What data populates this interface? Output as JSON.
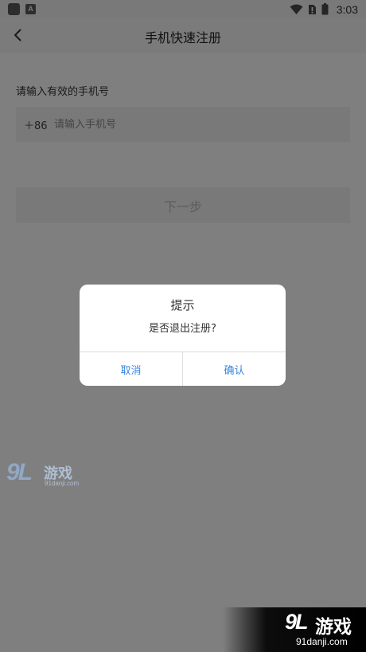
{
  "status_bar": {
    "time": "3:03",
    "notification_a": "A",
    "icons": [
      "app-notification-icon",
      "a-notification-icon",
      "wifi-icon",
      "no-sim-icon",
      "battery-icon"
    ]
  },
  "nav": {
    "title": "手机快速注册",
    "back_icon": "chevron-left-icon"
  },
  "form": {
    "phone_hint": "请输入有效的手机号",
    "country_code": "＋86",
    "phone_placeholder": "请输入手机号",
    "phone_value": "",
    "next_label": "下一步"
  },
  "dialog": {
    "title": "提示",
    "message": "是否退出注册?",
    "cancel_label": "取消",
    "confirm_label": "确认",
    "button_color": "#3a86e0"
  },
  "watermark": {
    "mark": "9L",
    "text": "游戏",
    "url_small": "91danji.com",
    "url_large": "91danji.com"
  }
}
